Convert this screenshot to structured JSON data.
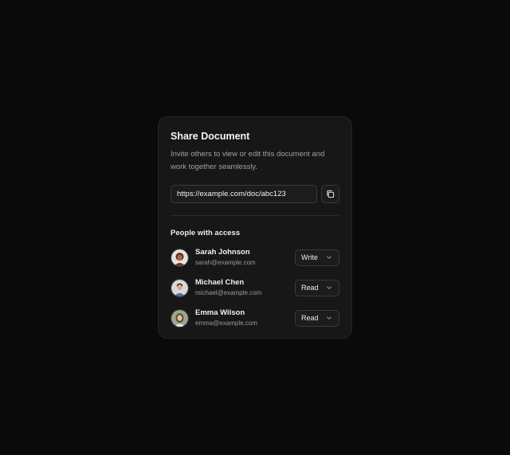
{
  "dialog": {
    "title": "Share Document",
    "description": "Invite others to view or edit this document and work together seamlessly.",
    "link_value": "https://example.com/doc/abc123",
    "copy_icon": "copy-icon",
    "section_title": "People with access"
  },
  "people": [
    {
      "name": "Sarah Johnson",
      "email": "sarah@example.com",
      "role": "Write"
    },
    {
      "name": "Michael Chen",
      "email": "michael@example.com",
      "role": "Read"
    },
    {
      "name": "Emma Wilson",
      "email": "emma@example.com",
      "role": "Read"
    }
  ],
  "colors": {
    "background": "#0a0a0a",
    "card": "#171717",
    "border": "#3a3a3a"
  }
}
